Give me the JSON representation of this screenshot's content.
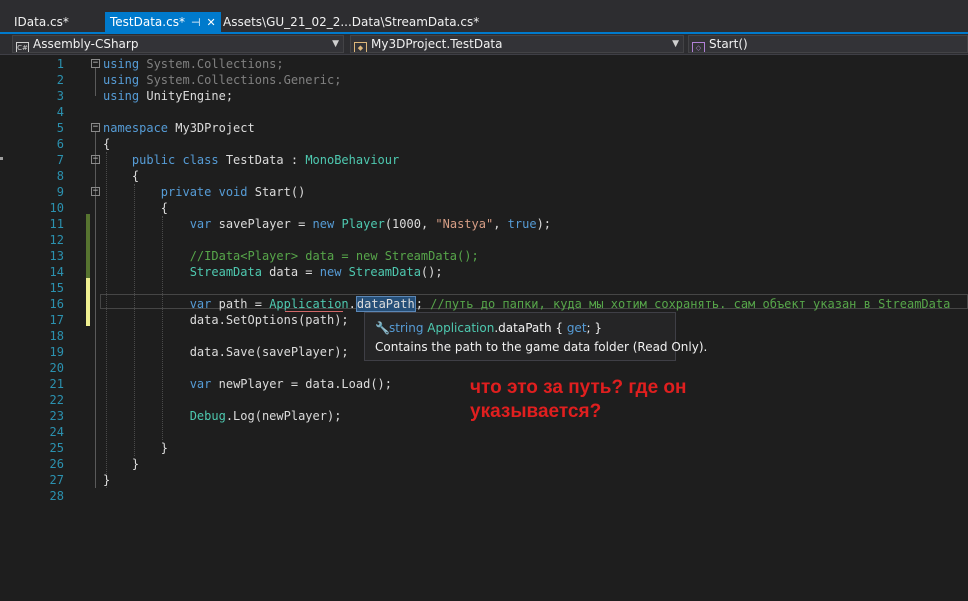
{
  "tabs": [
    {
      "label": "IData.cs*",
      "active": false
    },
    {
      "label": "TestData.cs*",
      "active": true,
      "pin_icon": "pin-icon",
      "close_icon": "close-icon"
    },
    {
      "label": "Assets\\GU_21_02_2...Data\\StreamData.cs*",
      "active": false
    }
  ],
  "navbar": {
    "project": "Assembly-CSharp",
    "type": "My3DProject.TestData",
    "member": "Start()"
  },
  "line_numbers": [
    "1",
    "2",
    "3",
    "4",
    "5",
    "6",
    "7",
    "8",
    "9",
    "10",
    "11",
    "12",
    "13",
    "14",
    "15",
    "16",
    "17",
    "18",
    "19",
    "20",
    "21",
    "22",
    "23",
    "24",
    "25",
    "26",
    "27",
    "28"
  ],
  "code": {
    "l1_kw": "using",
    "l1_rest": " System.Collections;",
    "l2_kw": "using",
    "l2_rest": " System.Collections.Generic;",
    "l3_kw": "using",
    "l3_rest": " UnityEngine;",
    "l5_kw": "namespace",
    "l5_rest": " My3DProject",
    "l6": "{",
    "l7_indent": "    ",
    "l7_kw": "public class",
    "l7_name": " TestData : ",
    "l7_base": "MonoBehaviour",
    "l8": "    {",
    "l9_indent": "        ",
    "l9_kw": "private void",
    "l9_rest": " Start()",
    "l10": "        {",
    "l11_indent": "            ",
    "l11_kw": "var",
    "l11_a": " savePlayer = ",
    "l11_new": "new",
    "l11_sp": " ",
    "l11_ty": "Player",
    "l11_b": "(1000, ",
    "l11_str": "\"Nastya\"",
    "l11_c": ", ",
    "l11_true": "true",
    "l11_d": ");",
    "l13_indent": "            ",
    "l13_cm": "//IData<Player> data = new StreamData();",
    "l14_indent": "            ",
    "l14_ty": "StreamData",
    "l14_a": " data = ",
    "l14_new": "new",
    "l14_sp": " ",
    "l14_ty2": "StreamData",
    "l14_b": "();",
    "l16_indent": "            ",
    "l16_kw": "var",
    "l16_a": " path = ",
    "l16_ty": "Application",
    "l16_dot": ".",
    "l16_hl": "dataPath",
    "l16_semi": "; ",
    "l16_cm": "//путь до папки, куда мы хотим сохранять. сам объект указан в StreamData",
    "l17": "            data.SetOptions(path);",
    "l19": "            data.Save(savePlayer);",
    "l21_indent": "            ",
    "l21_kw": "var",
    "l21_rest": " newPlayer = data.Load();",
    "l23_indent": "            ",
    "l23_ty": "Debug",
    "l23_rest": ".Log(newPlayer);",
    "l25": "        }",
    "l26": "    }",
    "l27": "}"
  },
  "tooltip": {
    "icon": "wrench-icon",
    "type_kw": "string",
    "class": "Application",
    "member": ".dataPath { ",
    "get": "get",
    "end": "; }",
    "description": "Contains the path to the game data folder (Read Only)."
  },
  "annotation": {
    "line1": "что это за путь? где он",
    "line2": "указывается?"
  },
  "colors": {
    "accent": "#007acc",
    "annotation": "#e01f1f",
    "saved_change": "#577430",
    "unsaved_change": "#efef91"
  }
}
